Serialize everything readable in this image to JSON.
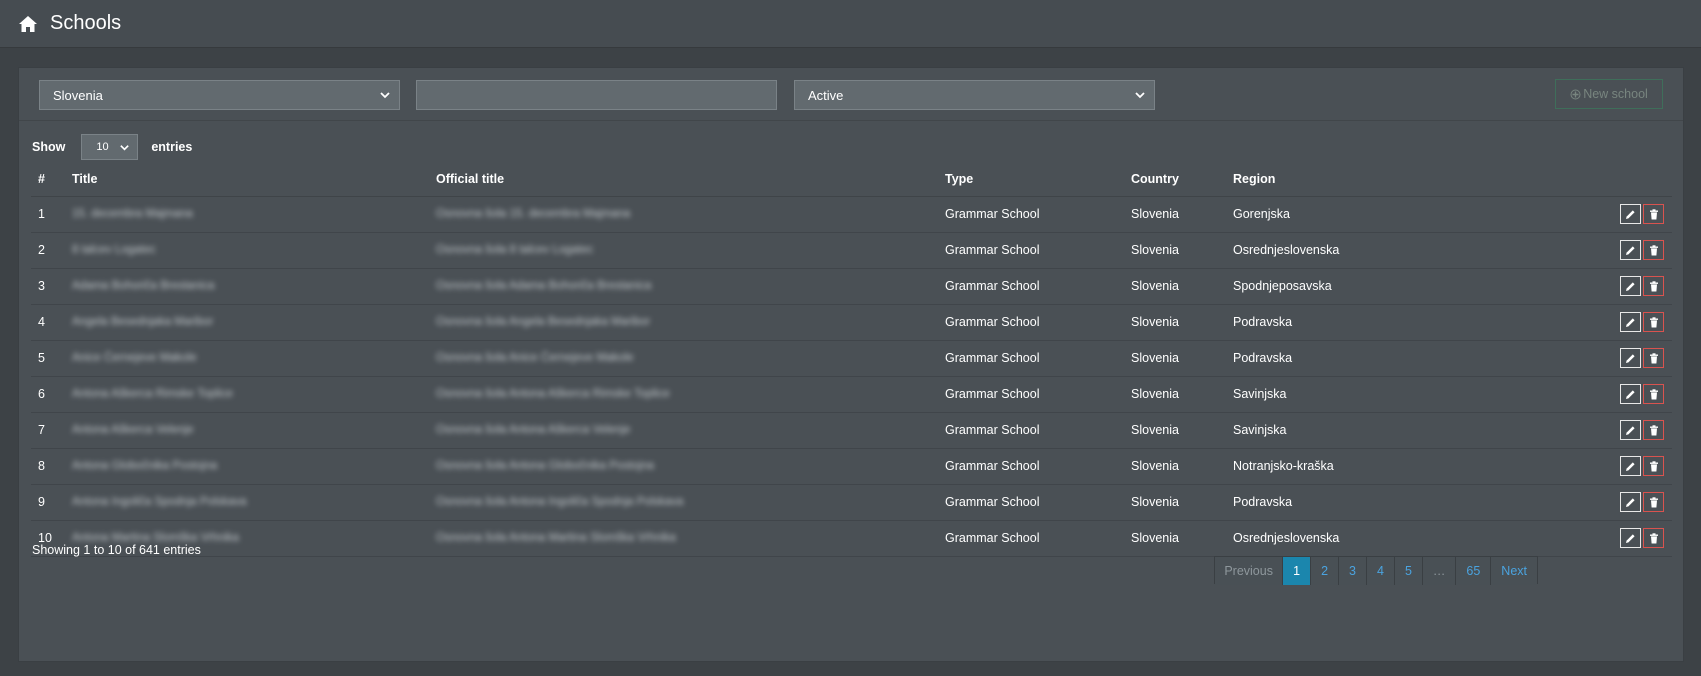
{
  "header": {
    "title": "Schools",
    "icon": "home-icon"
  },
  "filters": {
    "country": "Slovenia",
    "search_value": "",
    "status": "Active",
    "new_school_label": "New school"
  },
  "length": {
    "show_label": "Show",
    "value": "10",
    "entries_label": "entries"
  },
  "table": {
    "columns": [
      "#",
      "Title",
      "Official title",
      "Type",
      "Country",
      "Region"
    ],
    "rows": [
      {
        "num": "1",
        "title": "15. decembra Majmana",
        "official": "Osnovna šola 15. decembra Majmana",
        "type": "Grammar School",
        "country": "Slovenia",
        "region": "Gorenjska"
      },
      {
        "num": "2",
        "title": "8 talcev Logatec",
        "official": "Osnovna šola 8 talcev Logatec",
        "type": "Grammar School",
        "country": "Slovenia",
        "region": "Osrednjeslovenska"
      },
      {
        "num": "3",
        "title": "Adama Bohoriča Brestanica",
        "official": "Osnovna šola Adama Bohoriča Brestanica",
        "type": "Grammar School",
        "country": "Slovenia",
        "region": "Spodnjeposavska"
      },
      {
        "num": "4",
        "title": "Angela Besednjaka Maribor",
        "official": "Osnovna šola Angela Besednjaka Maribor",
        "type": "Grammar School",
        "country": "Slovenia",
        "region": "Podravska"
      },
      {
        "num": "5",
        "title": "Anice Černejeve Makole",
        "official": "Osnovna šola Anice Černejeve Makole",
        "type": "Grammar School",
        "country": "Slovenia",
        "region": "Podravska"
      },
      {
        "num": "6",
        "title": "Antona Aškerca Rimske Toplice",
        "official": "Osnovna šola Antona Aškerca Rimske Toplice",
        "type": "Grammar School",
        "country": "Slovenia",
        "region": "Savinjska"
      },
      {
        "num": "7",
        "title": "Antona Aškerca Velenje",
        "official": "Osnovna šola Antona Aškerca Velenje",
        "type": "Grammar School",
        "country": "Slovenia",
        "region": "Savinjska"
      },
      {
        "num": "8",
        "title": "Antona Globočnika Postojna",
        "official": "Osnovna šola Antona Globočnika Postojna",
        "type": "Grammar School",
        "country": "Slovenia",
        "region": "Notranjsko-kraška"
      },
      {
        "num": "9",
        "title": "Antona Ingoliča Spodnja Polskava",
        "official": "Osnovna šola Antona Ingoliča Spodnja Polskava",
        "type": "Grammar School",
        "country": "Slovenia",
        "region": "Podravska"
      },
      {
        "num": "10",
        "title": "Antona Martina Slomška Vrhnika",
        "official": "Osnovna šola Antona Martina Slomška Vrhnika",
        "type": "Grammar School",
        "country": "Slovenia",
        "region": "Osrednjeslovenska"
      }
    ]
  },
  "info": "Showing 1 to 10 of 641 entries",
  "pagination": {
    "previous": "Previous",
    "pages": [
      "1",
      "2",
      "3",
      "4",
      "5",
      "…",
      "65"
    ],
    "active": "1",
    "next": "Next"
  },
  "colors": {
    "accent": "#1b86ad",
    "link": "#4aa3df",
    "danger": "#d9534f"
  }
}
